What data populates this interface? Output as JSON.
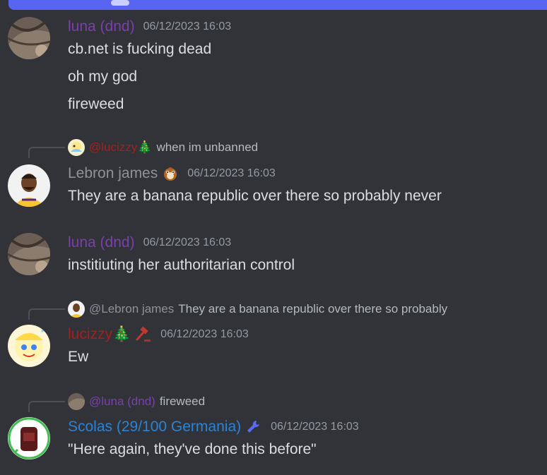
{
  "colors": {
    "background": "#313338",
    "text": "#dbdee1",
    "timestamp": "#949ba4",
    "luna_name": "#7b3fae",
    "lebron_name": "#8e9297",
    "lucizzy_name": "#a3201c",
    "scolas_name": "#2a83d6",
    "accent_bar": "#5865f2"
  },
  "messages": [
    {
      "author": "luna (dnd)",
      "timestamp": "06/12/2023 16:03",
      "lines": [
        "cb.net is fucking dead",
        "oh my god",
        "fireweed"
      ]
    },
    {
      "reply": {
        "mention": "@lucizzy",
        "emoji": "🎄",
        "text": "when im unbanned"
      },
      "author": "Lebron james",
      "badge": "hamster-icon",
      "timestamp": "06/12/2023 16:03",
      "lines": [
        "They are a banana republic over there so probably never"
      ]
    },
    {
      "author": "luna (dnd)",
      "timestamp": "06/12/2023 16:03",
      "lines": [
        "institiuting her authoritarian control"
      ]
    },
    {
      "reply": {
        "mention": "@Lebron james",
        "text": "They are a banana republic over there so probably"
      },
      "author": "lucizzy",
      "author_emoji": "🎄",
      "badge": "gavel-icon",
      "timestamp": "06/12/2023 16:03",
      "lines": [
        "Ew"
      ]
    },
    {
      "reply": {
        "mention": "@luna (dnd)",
        "text": "fireweed"
      },
      "author": "Scolas (29/100 Germania)",
      "badge": "wrench-icon",
      "timestamp": "06/12/2023 16:03",
      "lines": [
        "\"Here again, they've done this before\""
      ]
    }
  ]
}
